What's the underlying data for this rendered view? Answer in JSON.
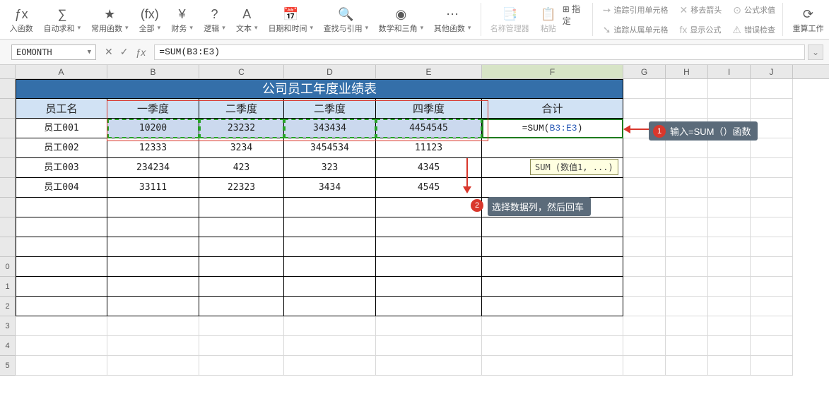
{
  "ribbon": {
    "insert_fn": "入函数",
    "autosum": "自动求和",
    "common_fn": "常用函数",
    "all": "全部",
    "finance": "财务",
    "logic": "逻辑",
    "text": "文本",
    "datetime": "日期和时间",
    "lookup": "查找与引用",
    "mathtrig": "数学和三角",
    "other_fn": "其他函数",
    "name_mgr": "名称管理器",
    "paste": "粘贴",
    "assign": "指定",
    "trace_prec": "追踪引用单元格",
    "trace_dep": "追踪从属单元格",
    "remove_arrows": "移去箭头",
    "show_formulas": "显示公式",
    "evaluate": "公式求值",
    "error_check": "错误检查",
    "recalc": "重算工作"
  },
  "formula_bar": {
    "name_box": "EOMONTH",
    "formula": "=SUM(B3:E3)"
  },
  "columns": [
    "A",
    "B",
    "C",
    "D",
    "E",
    "F",
    "G",
    "H",
    "I",
    "J"
  ],
  "table": {
    "title": "公司员工年度业绩表",
    "headers": [
      "员工名",
      "一季度",
      "二季度",
      "二季度",
      "四季度",
      "合计"
    ],
    "rows": [
      {
        "name": "员工001",
        "q1": "10200",
        "q2": "23232",
        "q3": "343434",
        "q4": "4454545",
        "sum": "=SUM(B3:E3)"
      },
      {
        "name": "员工002",
        "q1": "12333",
        "q2": "3234",
        "q3": "3454534",
        "q4": "11123",
        "sum": ""
      },
      {
        "name": "员工003",
        "q1": "234234",
        "q2": "423",
        "q3": "323",
        "q4": "4345",
        "sum": ""
      },
      {
        "name": "员工004",
        "q1": "33111",
        "q2": "22323",
        "q3": "3434",
        "q4": "4545",
        "sum": ""
      }
    ]
  },
  "active_cell_parts": {
    "prefix": "=SUM(",
    "ref": "B3:E3",
    "suffix": ")"
  },
  "tooltip": "SUM (数值1, ...)",
  "callouts": {
    "c1": "输入=SUM（）函数",
    "c2": "选择数据列，然后回车"
  }
}
